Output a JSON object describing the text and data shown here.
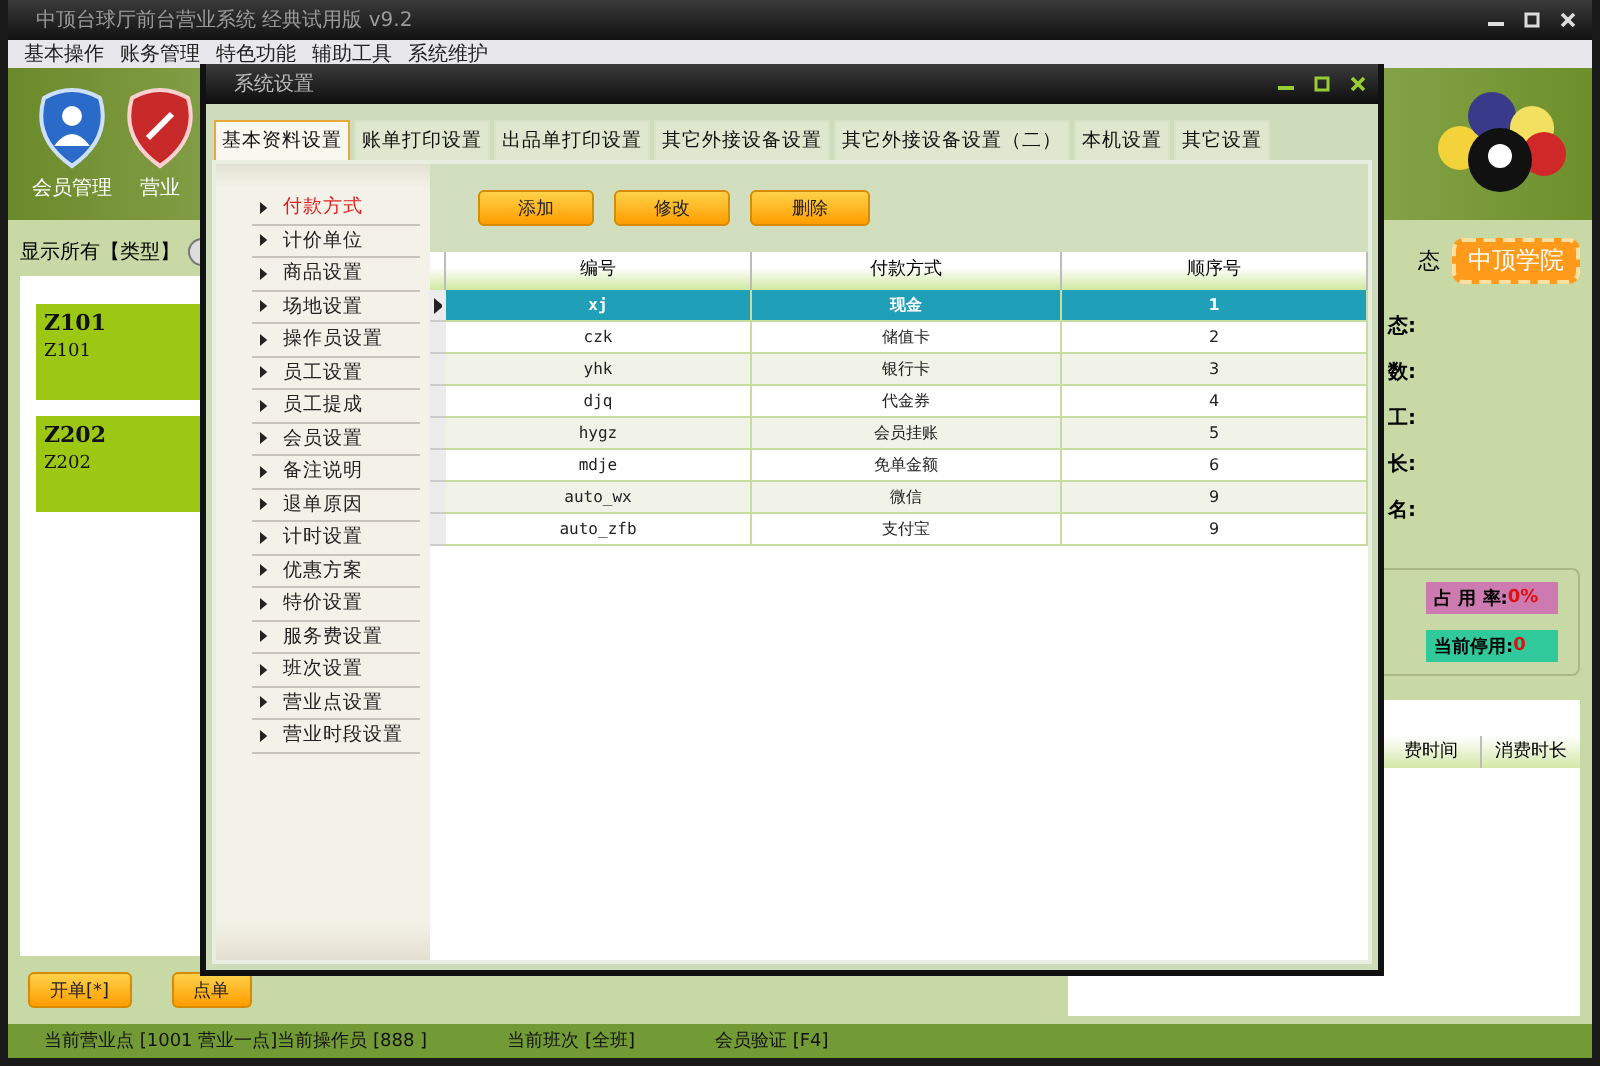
{
  "window": {
    "title": "中顶台球厅前台营业系统 经典试用版 v9.2"
  },
  "menu": [
    "基本操作",
    "账务管理",
    "特色功能",
    "辅助工具",
    "系统维护"
  ],
  "toolbar": [
    {
      "label": "会员管理",
      "kind": "member"
    },
    {
      "label": "营业",
      "kind": "business"
    }
  ],
  "filter": {
    "label": "显示所有【类型】"
  },
  "tables": [
    {
      "title": "Z101",
      "subtitle": "Z101"
    },
    {
      "title": "Z202",
      "subtitle": "Z202"
    }
  ],
  "status_heading": "态",
  "academy_button": "中顶学院",
  "info_labels": [
    "态:",
    "数:",
    "工:",
    "长:",
    "名:"
  ],
  "stats": [
    {
      "label": "占 用 率:",
      "value": "0%",
      "color": "#cc7ab0"
    },
    {
      "label": "当前停用:",
      "value": "0",
      "color": "#2fc99b"
    }
  ],
  "records_columns": [
    "费时间",
    "消费时长"
  ],
  "bottom_buttons": [
    "开单[*]",
    "点单"
  ],
  "status_bar": [
    "当前营业点 [1001 营业一点]当前操作员 [888 ]",
    "当前班次 [全班]",
    "会员验证 [F4]"
  ],
  "dialog": {
    "title": "系统设置",
    "tabs": [
      {
        "label": "基本资料设置",
        "selected": true
      },
      {
        "label": "账单打印设置",
        "selected": false
      },
      {
        "label": "出品单打印设置",
        "selected": false
      },
      {
        "label": "其它外接设备设置",
        "selected": false
      },
      {
        "label": "其它外接设备设置（二）",
        "selected": false
      },
      {
        "label": "本机设置",
        "selected": false
      },
      {
        "label": "其它设置",
        "selected": false
      }
    ],
    "categories": [
      {
        "label": "付款方式",
        "selected": true
      },
      {
        "label": "计价单位",
        "selected": false
      },
      {
        "label": "商品设置",
        "selected": false
      },
      {
        "label": "场地设置",
        "selected": false
      },
      {
        "label": "操作员设置",
        "selected": false
      },
      {
        "label": "员工设置",
        "selected": false
      },
      {
        "label": "员工提成",
        "selected": false
      },
      {
        "label": "会员设置",
        "selected": false
      },
      {
        "label": "备注说明",
        "selected": false
      },
      {
        "label": "退单原因",
        "selected": false
      },
      {
        "label": "计时设置",
        "selected": false
      },
      {
        "label": "优惠方案",
        "selected": false
      },
      {
        "label": "特价设置",
        "selected": false
      },
      {
        "label": "服务费设置",
        "selected": false
      },
      {
        "label": "班次设置",
        "selected": false
      },
      {
        "label": "营业点设置",
        "selected": false
      },
      {
        "label": "营业时段设置",
        "selected": false
      }
    ],
    "actions": [
      "添加",
      "修改",
      "删除"
    ],
    "columns": [
      "编号",
      "付款方式",
      "顺序号"
    ],
    "rows": [
      {
        "cells": [
          "xj",
          "现金",
          "1"
        ],
        "selected": true
      },
      {
        "cells": [
          "czk",
          "储值卡",
          "2"
        ],
        "selected": false
      },
      {
        "cells": [
          "yhk",
          "银行卡",
          "3"
        ],
        "selected": false
      },
      {
        "cells": [
          "djq",
          "代金券",
          "4"
        ],
        "selected": false
      },
      {
        "cells": [
          "hygz",
          "会员挂账",
          "5"
        ],
        "selected": false
      },
      {
        "cells": [
          "mdje",
          "免单金额",
          "6"
        ],
        "selected": false
      },
      {
        "cells": [
          "auto_wx",
          "微信",
          "9"
        ],
        "selected": false
      },
      {
        "cells": [
          "auto_zfb",
          "支付宝",
          "9"
        ],
        "selected": false
      }
    ]
  }
}
